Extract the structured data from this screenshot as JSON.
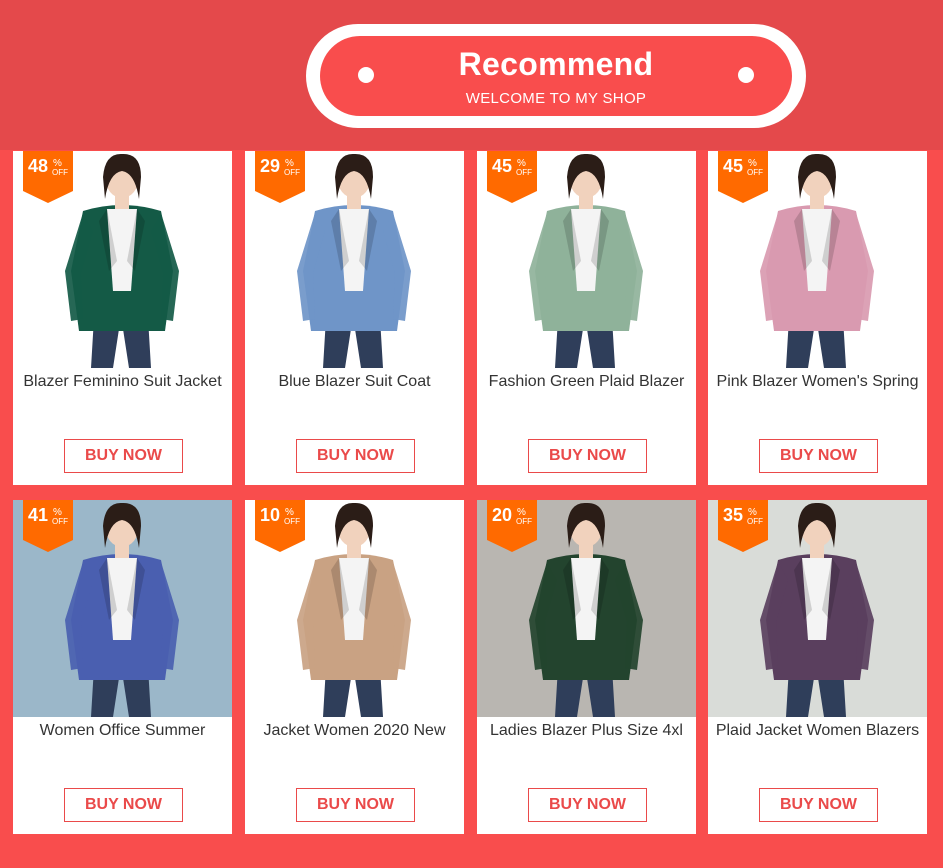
{
  "header": {
    "title": "Recommend",
    "subtitle": "WELCOME TO MY SHOP"
  },
  "colors": {
    "brand_red": "#f94d4d",
    "header_red": "#e4494b",
    "badge_orange": "#ff6a00",
    "button_red": "#ea4a4a"
  },
  "products": [
    {
      "discount": "48",
      "pct": "%",
      "off": "OFF",
      "title": "Blazer Feminino Suit Jacket",
      "buy_label": "BUY NOW",
      "jacket_color": "#145a46",
      "bg_color": "#ffffff"
    },
    {
      "discount": "29",
      "pct": "%",
      "off": "OFF",
      "title": "Blue Blazer Suit Coat",
      "buy_label": "BUY NOW",
      "jacket_color": "#6f95c8",
      "bg_color": "#ffffff"
    },
    {
      "discount": "45",
      "pct": "%",
      "off": "OFF",
      "title": "Fashion Green Plaid Blazer",
      "buy_label": "BUY NOW",
      "jacket_color": "#8fb29a",
      "bg_color": "#ffffff"
    },
    {
      "discount": "45",
      "pct": "%",
      "off": "OFF",
      "title": "Pink Blazer Women's Spring",
      "buy_label": "BUY NOW",
      "jacket_color": "#d99ab0",
      "bg_color": "#ffffff"
    },
    {
      "discount": "41",
      "pct": "%",
      "off": "OFF",
      "title": "Women Office Summer",
      "buy_label": "BUY NOW",
      "jacket_color": "#4a5fb0",
      "bg_color": "#9bb7c9"
    },
    {
      "discount": "10",
      "pct": "%",
      "off": "OFF",
      "title": "Jacket Women 2020 New",
      "buy_label": "BUY NOW",
      "jacket_color": "#c9a283",
      "bg_color": "#ffffff"
    },
    {
      "discount": "20",
      "pct": "%",
      "off": "OFF",
      "title": "Ladies Blazer Plus Size 4xl",
      "buy_label": "BUY NOW",
      "jacket_color": "#23442e",
      "bg_color": "#b9b6b1"
    },
    {
      "discount": "35",
      "pct": "%",
      "off": "OFF",
      "title": "Plaid Jacket Women Blazers",
      "buy_label": "BUY NOW",
      "jacket_color": "#5a3f5e",
      "bg_color": "#d9dcd8"
    }
  ]
}
